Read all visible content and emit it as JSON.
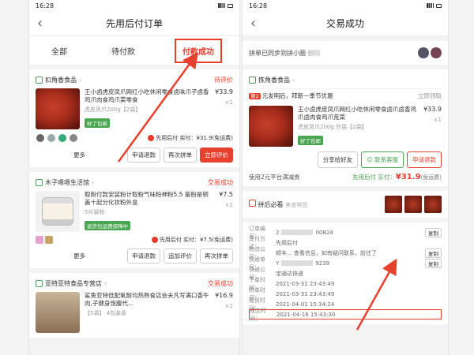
{
  "left": {
    "status_time": "16:28",
    "title": "先用后付订单",
    "tabs": [
      "全部",
      "待付款",
      "付款成功"
    ],
    "orders": [
      {
        "shop": "扣角香食品",
        "status": "待评价",
        "title": "王小卤虎皮凤爪网红小吃休闲零食卤味爪子卤香鸡爪肉食鸡爪菜零食",
        "spec": "虎皮凤爪200g【2袋】",
        "badge": "好了包邮",
        "price": "¥33.9",
        "qty": "×1",
        "pay_text": "先用后付 实付：¥31.9(免运费)",
        "buttons": [
          "更多",
          "申请退款",
          "再次拼单",
          "立即评价"
        ]
      },
      {
        "shop": "木子嗯嗯生活馆",
        "status": "交易成功",
        "title": "取粉付款安装粉计取粉气味粉神粉5.5 鉴粉是铜盖十起分化妆粉外盒",
        "spec": "5片装粉",
        "badge": "退货包运费保障中",
        "price": "¥7.5",
        "qty": "×1",
        "pay_text": "先用后付 实付：¥7.5(免运费)",
        "buttons": [
          "更多",
          "申请退款",
          "追加评价",
          "再次拼单"
        ]
      },
      {
        "shop": "亚特亚特食品专营店",
        "status": "交易成功",
        "title": "鲨鱼亚特低配氧耐均热熟食店会夫凡写满口香牛肉,子健身饱腹代...",
        "spec": "【5袋】 4包装装",
        "price": "¥16.9",
        "qty": "×1"
      }
    ]
  },
  "right": {
    "status_time": "16:28",
    "title": "交易成功",
    "sync_text": "拼单已同步到拼小圈",
    "sync_hint": "删除",
    "shop": "拣角香食品",
    "shop_arrow": "›",
    "notice_tag": "第2",
    "notice_text": "元发明后，拜新一季节优惠",
    "notice_action": "立即领取",
    "product": {
      "title": "王小卤虎皮凤爪网红小吃休闲零食卤爪卤香鸡爪卤肉食鸡爪荒菜",
      "spec": "虎皮凤爪200g 外袋【2袋】",
      "badge": "好了包邮",
      "price": "¥33.9",
      "qty": "×1"
    },
    "buttons": [
      "分享给好友",
      "联系客服",
      "申请退款"
    ],
    "pay_left": "使用2元平台满减券",
    "pay_right_label": "先用后付 实付：",
    "pay_total": "¥31.9",
    "pay_note": "(免运费)",
    "pin_title": "拼后必看",
    "pin_sub": "美食常团",
    "info": [
      {
        "label": "订单编号：",
        "value": "2",
        "suffix": "00824",
        "copy": "复制"
      },
      {
        "label": "支付方式：",
        "value": "先用后付",
        "copy": ""
      },
      {
        "label": "物流公司：",
        "value": "顺丰... 查看信息，如有疑问联系，前往了",
        "copy": "复制"
      },
      {
        "label": "快递单号：",
        "value": "Y",
        "suffix": "9239",
        "copy": "复制"
      },
      {
        "label": "快递公司：",
        "value": "宝通达快递",
        "copy": ""
      },
      {
        "label": "下单时间：",
        "value": "2021-03-31 23:43:49",
        "copy": ""
      },
      {
        "label": "拼单时间：",
        "value": "2021-03-31 23:43:49",
        "copy": ""
      },
      {
        "label": "发货时间：",
        "value": "2021-04-01 15:34:24",
        "copy": ""
      },
      {
        "label": "成交时间：",
        "value": "2021-04-16 15:43:30",
        "copy": ""
      }
    ]
  },
  "colors": {
    "accent": "#e8402e",
    "green": "#47a64f"
  }
}
